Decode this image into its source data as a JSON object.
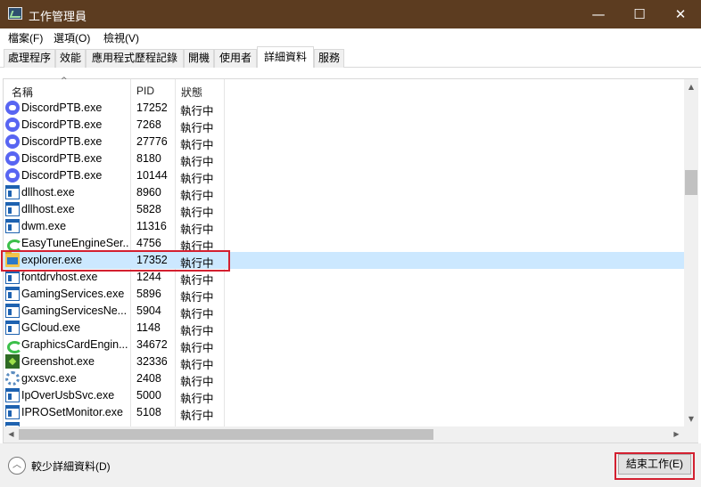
{
  "window": {
    "title": "工作管理員",
    "minimize_glyph": "—",
    "maximize_glyph": "☐",
    "close_glyph": "✕",
    "titlebar_color": "#5c3c20"
  },
  "menu": [
    "檔案(F)",
    "選項(O)",
    "檢視(V)"
  ],
  "tabs": [
    {
      "label": "處理程序"
    },
    {
      "label": "效能"
    },
    {
      "label": "應用程式歷程記錄"
    },
    {
      "label": "開機"
    },
    {
      "label": "使用者"
    },
    {
      "label": "詳細資料",
      "active": true
    },
    {
      "label": "服務"
    }
  ],
  "columns": {
    "name": "名稱",
    "pid": "PID",
    "status": "狀態",
    "sort_arrow": "^"
  },
  "rows": [
    {
      "icon": "discord-icon",
      "name": "DiscordPTB.exe",
      "pid": "17252",
      "status": "執行中"
    },
    {
      "icon": "discord-icon",
      "name": "DiscordPTB.exe",
      "pid": "7268",
      "status": "執行中"
    },
    {
      "icon": "discord-icon",
      "name": "DiscordPTB.exe",
      "pid": "27776",
      "status": "執行中"
    },
    {
      "icon": "discord-icon",
      "name": "DiscordPTB.exe",
      "pid": "8180",
      "status": "執行中"
    },
    {
      "icon": "discord-icon",
      "name": "DiscordPTB.exe",
      "pid": "10144",
      "status": "執行中"
    },
    {
      "icon": "window-icon",
      "name": "dllhost.exe",
      "pid": "8960",
      "status": "執行中"
    },
    {
      "icon": "window-icon",
      "name": "dllhost.exe",
      "pid": "5828",
      "status": "執行中"
    },
    {
      "icon": "window-icon",
      "name": "dwm.exe",
      "pid": "11316",
      "status": "執行中"
    },
    {
      "icon": "easytune-icon",
      "name": "EasyTuneEngineSer...",
      "pid": "4756",
      "status": "執行中"
    },
    {
      "icon": "folder-icon",
      "name": "explorer.exe",
      "pid": "17352",
      "status": "執行中",
      "selected": true
    },
    {
      "icon": "window-icon",
      "name": "fontdrvhost.exe",
      "pid": "1244",
      "status": "執行中"
    },
    {
      "icon": "window-icon",
      "name": "GamingServices.exe",
      "pid": "5896",
      "status": "執行中"
    },
    {
      "icon": "window-icon",
      "name": "GamingServicesNe...",
      "pid": "5904",
      "status": "執行中"
    },
    {
      "icon": "window-icon",
      "name": "GCloud.exe",
      "pid": "1148",
      "status": "執行中"
    },
    {
      "icon": "easytune-icon",
      "name": "GraphicsCardEngin...",
      "pid": "34672",
      "status": "執行中"
    },
    {
      "icon": "greenshot-icon",
      "name": "Greenshot.exe",
      "pid": "32336",
      "status": "執行中"
    },
    {
      "icon": "gear-icon",
      "name": "gxxsvc.exe",
      "pid": "2408",
      "status": "執行中"
    },
    {
      "icon": "window-icon",
      "name": "IpOverUsbSvc.exe",
      "pid": "5000",
      "status": "執行中"
    },
    {
      "icon": "window-icon",
      "name": "IPROSetMonitor.exe",
      "pid": "5108",
      "status": "執行中"
    },
    {
      "icon": "window-icon",
      "name": "",
      "pid": "",
      "status": ""
    }
  ],
  "footer": {
    "less_details_label": "較少詳細資料(D)",
    "end_task_label": "結束工作(E)"
  },
  "colors": {
    "selection": "#cce8ff",
    "highlight_box": "#d32030"
  }
}
